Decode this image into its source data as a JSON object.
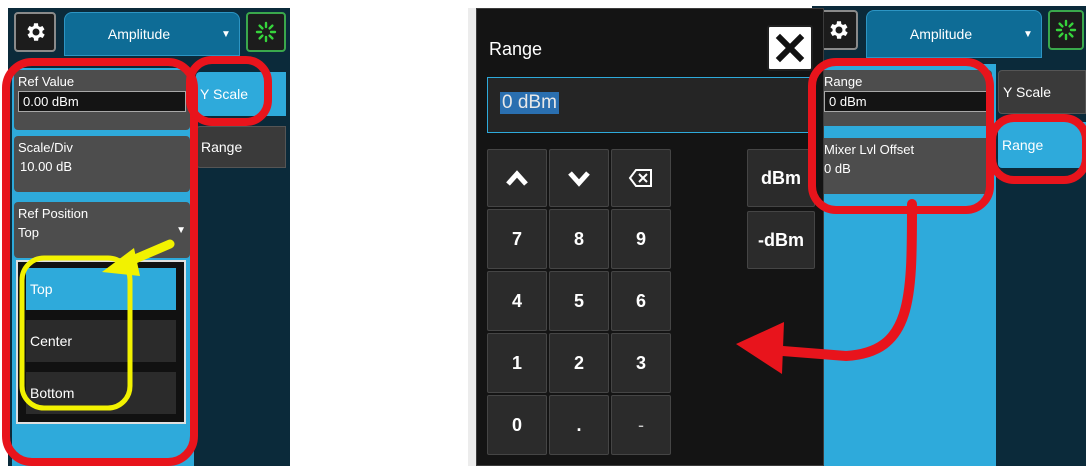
{
  "left_panel": {
    "menu_title": "Amplitude",
    "ref_value": {
      "label": "Ref Value",
      "value": "0.00 dBm"
    },
    "scale_div": {
      "label": "Scale/Div",
      "value": "10.00 dB"
    },
    "ref_position": {
      "label": "Ref Position",
      "value": "Top",
      "options": [
        "Top",
        "Center",
        "Bottom"
      ]
    },
    "tabs": [
      "Y Scale",
      "Range"
    ]
  },
  "keypad": {
    "title": "Range",
    "entry": "0 dBm",
    "keys": {
      "up": "↑",
      "down": "↓",
      "backspace": "⌫",
      "seven": "7",
      "eight": "8",
      "nine": "9",
      "four": "4",
      "five": "5",
      "six": "6",
      "one": "1",
      "two": "2",
      "three": "3",
      "zero": "0",
      "dot": ".",
      "minus": "-"
    },
    "unit_buttons": [
      "dBm",
      "-dBm"
    ]
  },
  "right_panel": {
    "menu_title": "Amplitude",
    "range": {
      "label": "Range",
      "value": "0 dBm"
    },
    "mixer_level_offset": {
      "label": "Mixer Lvl Offset",
      "value": "0 dB"
    },
    "tabs": [
      "Y Scale",
      "Range"
    ]
  },
  "colors": {
    "accent_blue": "#2eaadb",
    "annotation_red": "#e8141c",
    "annotation_yellow": "#f2f200",
    "spinner_green": "#36d43c"
  },
  "icons": [
    "gear-icon",
    "dropdown-arrow-icon",
    "spinner-icon",
    "close-icon",
    "chevron-up-icon",
    "chevron-down-icon",
    "backspace-icon"
  ]
}
